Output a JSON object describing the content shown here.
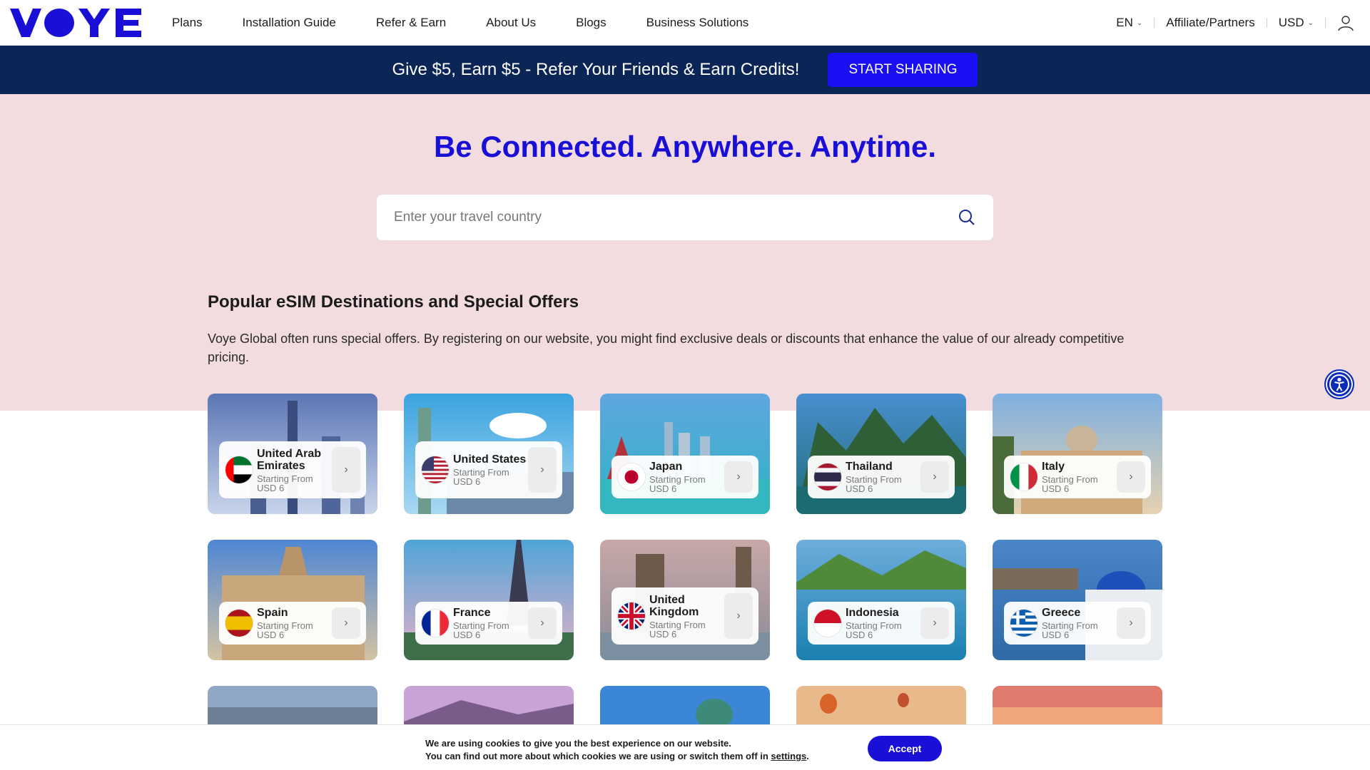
{
  "brand": {
    "logo_text": "VOYE",
    "color": "#1a0fd6"
  },
  "nav": {
    "items": [
      "Plans",
      "Installation Guide",
      "Refer & Earn",
      "About Us",
      "Blogs",
      "Business Solutions"
    ]
  },
  "header_right": {
    "language": "EN",
    "affiliate": "Affiliate/Partners",
    "currency": "USD"
  },
  "banner": {
    "text": "Give $5, Earn $5 - Refer Your Friends & Earn Credits!",
    "button": "START SHARING",
    "background": "#0b2656",
    "button_color": "#1a0ff2"
  },
  "hero": {
    "title": "Be Connected. Anywhere. Anytime.",
    "search_placeholder": "Enter your travel country",
    "background": "#f2dcdf"
  },
  "section": {
    "title": "Popular eSIM Destinations and Special Offers",
    "description": "Voye Global often runs special offers. By registering on our website, you might find exclusive deals or discounts that enhance the value of our already competitive pricing."
  },
  "destinations": [
    {
      "name": "United Arab Emirates",
      "label": "Starting From",
      "price": "USD 6",
      "flag": "uae"
    },
    {
      "name": "United States",
      "label": "Starting From",
      "price": "USD 6",
      "flag": "usa"
    },
    {
      "name": "Japan",
      "label": "Starting From",
      "price": "USD 6",
      "flag": "japan"
    },
    {
      "name": "Thailand",
      "label": "Starting From",
      "price": "USD 6",
      "flag": "thailand"
    },
    {
      "name": "Italy",
      "label": "Starting From",
      "price": "USD 6",
      "flag": "italy"
    },
    {
      "name": "Spain",
      "label": "Starting From",
      "price": "USD 6",
      "flag": "spain"
    },
    {
      "name": "France",
      "label": "Starting From",
      "price": "USD 6",
      "flag": "france"
    },
    {
      "name": "United Kingdom",
      "label": "Starting From",
      "price": "USD 6",
      "flag": "uk"
    },
    {
      "name": "Indonesia",
      "label": "Starting From",
      "price": "USD 6",
      "flag": "indonesia"
    },
    {
      "name": "Greece",
      "label": "Starting From",
      "price": "USD 6",
      "flag": "greece"
    }
  ],
  "cookie": {
    "line1": "We are using cookies to give you the best experience on our website.",
    "line2_prefix": "You can find out more about which cookies we are using or switch them off in ",
    "link": "settings",
    "line2_suffix": ".",
    "accept": "Accept"
  }
}
